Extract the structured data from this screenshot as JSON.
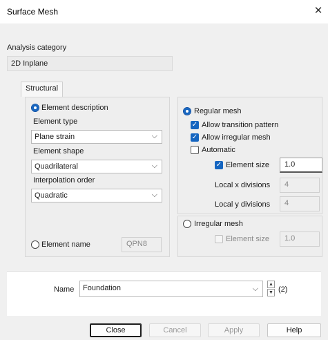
{
  "window": {
    "title": "Surface Mesh",
    "close_glyph": "✕"
  },
  "analysis": {
    "label": "Analysis category",
    "value": "2D Inplane"
  },
  "tabs": [
    {
      "label": "Structural"
    }
  ],
  "left_panel": {
    "element_description_label": "Element description",
    "element_type_label": "Element type",
    "element_type_value": "Plane strain",
    "element_shape_label": "Element shape",
    "element_shape_value": "Quadrilateral",
    "interpolation_label": "Interpolation order",
    "interpolation_value": "Quadratic",
    "element_name_label": "Element name",
    "element_name_value": "QPN8"
  },
  "right_panel": {
    "regular_mesh_label": "Regular mesh",
    "allow_transition_label": "Allow transition pattern",
    "allow_irregular_label": "Allow irregular mesh",
    "automatic_label": "Automatic",
    "element_size_label": "Element size",
    "element_size_value": "1.0",
    "local_x_label": "Local x divisions",
    "local_x_value": "4",
    "local_y_label": "Local y divisions",
    "local_y_value": "4",
    "irregular_mesh_label": "Irregular mesh",
    "irregular_element_size_label": "Element size",
    "irregular_element_size_value": "1.0"
  },
  "name_row": {
    "label": "Name",
    "value": "Foundation",
    "count": "(2)"
  },
  "buttons": {
    "close": "Close",
    "cancel": "Cancel",
    "apply": "Apply",
    "help": "Help"
  },
  "icons": {
    "chevron": "⌵",
    "spin_up": "▲",
    "spin_down": "▼",
    "check": "✓"
  },
  "colors": {
    "accent": "#1565c0",
    "background": "#f0f0f0"
  }
}
